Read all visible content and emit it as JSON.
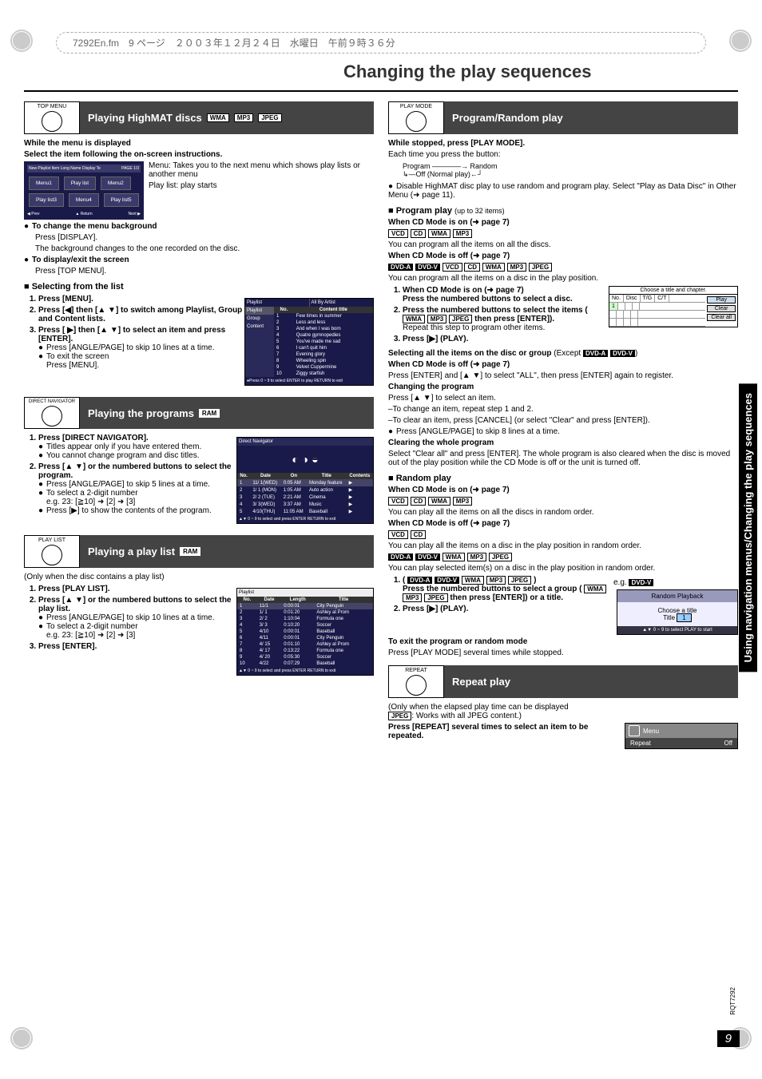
{
  "meta": {
    "header_line": "7292En.fm　9 ページ　２００３年１２月２４日　水曜日　午前９時３６分",
    "main_title": "Changing the play sequences",
    "side_tab": "Using navigation menus/Changing the play sequences",
    "page_number": "9",
    "page_code": "RQT7292"
  },
  "left": {
    "highmat": {
      "button_label": "TOP MENU",
      "title": "Playing HighMAT discs",
      "tags": [
        "WMA",
        "MP3",
        "JPEG"
      ],
      "intro1": "While the menu is displayed",
      "intro2": "Select the item following the on-screen instructions.",
      "menu_desc_label": "Menu:",
      "menu_desc": "Takes you to the next menu which shows play lists or another menu",
      "playlist_desc_label": "Play list:",
      "playlist_desc": "play starts",
      "osd_top": "New Playlist Item Long Name Display Te",
      "osd_page": "PAGE 1/3",
      "osd_cells": [
        "Menu1",
        "Play list",
        "Menu2",
        "Play list3",
        "Menu4",
        "Play list5"
      ],
      "osd_footer": [
        "◀ Prev",
        "▲ Return",
        "Next ▶"
      ],
      "bul1_t": "To change the menu background",
      "bul1_b1": "Press [DISPLAY].",
      "bul1_b2": "The background changes to the one recorded on the disc.",
      "bul2_t": "To display/exit the screen",
      "bul2_b": "Press [TOP MENU]."
    },
    "selecting": {
      "title": "Selecting from the list",
      "s1": "Press [MENU].",
      "s2": "Press [◀] then [▲ ▼] to switch among Playlist, Group and Content lists.",
      "s3": "Press [ ▶] then [▲ ▼] to select an item and press [ENTER].",
      "b1": "Press [ANGLE/PAGE] to skip 10 lines at a time.",
      "b2t": "To exit the screen",
      "b2b": "Press [MENU].",
      "osd": {
        "tabs": [
          "Playlist",
          "All By Artist"
        ],
        "side": [
          "Playlist",
          "Group",
          "Content"
        ],
        "head": [
          "No.",
          "Content title"
        ],
        "rows": [
          [
            "1",
            "Few times in summer"
          ],
          [
            "2",
            "Less and less"
          ],
          [
            "3",
            "And when I was born"
          ],
          [
            "4",
            "Quatre gymnopedies"
          ],
          [
            "5",
            "You've made me sad"
          ],
          [
            "6",
            "I can't quit him"
          ],
          [
            "7",
            "Evening glory"
          ],
          [
            "8",
            "Wheeling spin"
          ],
          [
            "9",
            "Velvet Cuppermine"
          ],
          [
            "10",
            "Ziggy starfish"
          ]
        ],
        "footer": "●Press 0 ~ 9 to select   ENTER to play                          RETURN to exit"
      }
    },
    "programs": {
      "button_label": "DIRECT NAVIGATOR",
      "title": "Playing the programs",
      "tag": "RAM",
      "s1": "Press [DIRECT NAVIGATOR].",
      "s1b1": "Titles appear only if you have entered them.",
      "s1b2": "You cannot change program and disc titles.",
      "s2": "Press [▲ ▼] or the numbered buttons to select the program.",
      "s2b1": "Press [ANGLE/PAGE] to skip 5 lines at a time.",
      "s2b2t": "To select a 2-digit number",
      "s2b2b": "e.g. 23: [≧10] ➜ [2] ➜ [3]",
      "s2b3": "Press [▶] to show the contents of the program.",
      "osd": {
        "title": "Direct Navigator",
        "head": [
          "No.",
          "Date",
          "On",
          "Title",
          "Contents"
        ],
        "rows": [
          [
            "1",
            "11/ 1(WED)",
            "0:05 AM",
            "Monday feature",
            ""
          ],
          [
            "2",
            "1/ 1 (MON)",
            "1:05 AM",
            "Auto action",
            ""
          ],
          [
            "3",
            "2/ 2 (TUE)",
            "2:21 AM",
            "Cinema",
            ""
          ],
          [
            "4",
            "3/ 3(WED)",
            "3:37 AM",
            "Music",
            ""
          ],
          [
            "5",
            "4/10(THU)",
            "11:05 AM",
            "Baseball",
            ""
          ]
        ],
        "footer": "▲▼ 0 ~ 9 to select and press ENTER               RETURN to exit"
      }
    },
    "playlist": {
      "button_label": "PLAY LIST",
      "title": "Playing a play list",
      "tag": "RAM",
      "note": "(Only when the disc contains a play list)",
      "s1": "Press [PLAY LIST].",
      "s2": "Press [▲ ▼] or the numbered buttons to select the play list.",
      "s2b1": "Press [ANGLE/PAGE] to skip 10 lines at a time.",
      "s2b2t": "To select a 2-digit number",
      "s2b2b": "e.g. 23: [≧10] ➜ [2] ➜ [3]",
      "s3": "Press [ENTER].",
      "osd": {
        "title": "Playlist",
        "head": [
          "No.",
          "Date",
          "Length",
          "Title"
        ],
        "rows": [
          [
            "1",
            "11/1",
            "0:00:01",
            "City Penguin"
          ],
          [
            "2",
            "1/ 1",
            "0:01:20",
            "Ashley at Prom"
          ],
          [
            "3",
            "2/ 2",
            "1:10:04",
            "Formula one"
          ],
          [
            "4",
            "3/ 3",
            "0:10:20",
            "Soccer"
          ],
          [
            "5",
            "4/10",
            "0:00:01",
            "Baseball"
          ],
          [
            "6",
            "4/11",
            "0:00:01",
            "City Penguin"
          ],
          [
            "7",
            "4/ 15",
            "0:01:10",
            "Ashley at Prom"
          ],
          [
            "8",
            "4/ 17",
            "0:13:22",
            "Formula one"
          ],
          [
            "9",
            "4/ 20",
            "0:05:30",
            "Soccer"
          ],
          [
            "10",
            "4/22",
            "0:07:29",
            "Baseball"
          ]
        ],
        "footer": "▲▼ 0 ~ 9 to select and press ENTER               RETURN to exit"
      }
    }
  },
  "right": {
    "program_random": {
      "button_label": "PLAY MODE",
      "title": "Program/Random play",
      "intro": "While stopped, press [PLAY MODE].",
      "intro2": "Each time you press the button:",
      "flow_a": "Program ————→ Random",
      "flow_b": "↳—Off (Normal play)←┘",
      "disable": "Disable HighMAT disc play to use random and program play. Select \"Play as Data Disc\" in Other Menu (➜ page 11)."
    },
    "program_play": {
      "title": "Program play",
      "subtitle": "(up to 32 items)",
      "cd_on": "When CD Mode is on (➜ page 7)",
      "cd_on_tags": [
        "VCD",
        "CD",
        "WMA",
        "MP3"
      ],
      "cd_on_body": "You can program all the items on all the discs.",
      "cd_off": "When CD Mode is off (➜ page 7)",
      "cd_off_tags": [
        "DVD-A",
        "DVD-V",
        "VCD",
        "CD",
        "WMA",
        "MP3",
        "JPEG"
      ],
      "cd_off_body": "You can program all the items on a disc in the play position.",
      "s1a": "When CD Mode is on (➜ page 7)",
      "s1b": "Press the numbered buttons to select a disc.",
      "s2": "Press the numbered buttons to select the items (",
      "s2_tags": [
        "WMA",
        "MP3",
        "JPEG"
      ],
      "s2b": "then press [ENTER]).",
      "s2c": "Repeat this step to program other items.",
      "s3": "Press [▶] (PLAY).",
      "box": {
        "caption": "Choose a title and chapter.",
        "head": [
          "No.",
          "Disc",
          "T/G",
          "C/T"
        ],
        "rows": [
          [
            "1",
            "",
            "",
            ""
          ]
        ],
        "btns": [
          "Play",
          "Clear",
          "Clear all"
        ]
      },
      "sel_all_t": "Selecting all the items on the disc or group",
      "sel_all_except": "(Except",
      "sel_all_tags": [
        "DVD-A",
        "DVD-V"
      ],
      "sel_all_close": ")",
      "sel_all_1": "When CD Mode is off (➜ page 7)",
      "sel_all_2": "Press [ENTER] and [▲ ▼] to select \"ALL\", then press [ENTER] again to register.",
      "chg_t": "Changing the program",
      "chg_1": "Press [▲ ▼] to select an item.",
      "chg_2": "–To change an item, repeat step 1 and 2.",
      "chg_3": "–To clear an item, press [CANCEL] (or select \"Clear\" and press [ENTER]).",
      "chg_4": "Press [ANGLE/PAGE] to skip 8 lines at a time.",
      "clr_t": "Clearing the whole program",
      "clr_b": "Select \"Clear all\" and press [ENTER]. The whole program is also cleared when the disc is moved out of the play position while the CD Mode is off or the unit is turned off."
    },
    "random_play": {
      "title": "Random play",
      "cd_on": "When CD Mode is on (➜ page 7)",
      "cd_on_tags": [
        "VCD",
        "CD",
        "WMA",
        "MP3"
      ],
      "cd_on_body": "You can play all the items on all the discs in random order.",
      "cd_off": "When CD Mode is off (➜ page 7)",
      "cd_off_tags1": [
        "VCD",
        "CD"
      ],
      "cd_off_body1": "You can play all the items on a disc in the play position in random order.",
      "cd_off_tags2": [
        "DVD-A",
        "DVD-V",
        "WMA",
        "MP3",
        "JPEG"
      ],
      "cd_off_body2": "You can play selected item(s) on a disc in the play position in random order.",
      "s1_open": "(",
      "s1_tags": [
        "DVD-A",
        "DVD-V",
        "WMA",
        "MP3",
        "JPEG"
      ],
      "s1_close": ")",
      "s1a": "Press the numbered buttons to select a group (",
      "s1a_tags": [
        "WMA",
        "MP3",
        "JPEG"
      ],
      "s1b": "then press [ENTER]) or a title.",
      "s2": "Press [▶] (PLAY).",
      "eg_label": "e.g.",
      "eg_tag": "DVD-V",
      "osd": {
        "title": "Random Playback",
        "body1": "Choose a title",
        "body2": "Title",
        "body2_val": "1",
        "footer": "▲▼ 0 ~ 9 to select     PLAY to start"
      },
      "exit_t": "To exit the program or random mode",
      "exit_b": "Press [PLAY MODE] several times while stopped."
    },
    "repeat": {
      "button_label": "REPEAT",
      "title": "Repeat play",
      "note1": "(Only when the elapsed play time can be displayed",
      "note2_tag": "JPEG",
      "note2": ": Works with all JPEG content.)",
      "body": "Press [REPEAT] several times to select an item to be repeated.",
      "osd": {
        "menu": "Menu",
        "label": "Repeat",
        "value": "Off"
      }
    }
  }
}
